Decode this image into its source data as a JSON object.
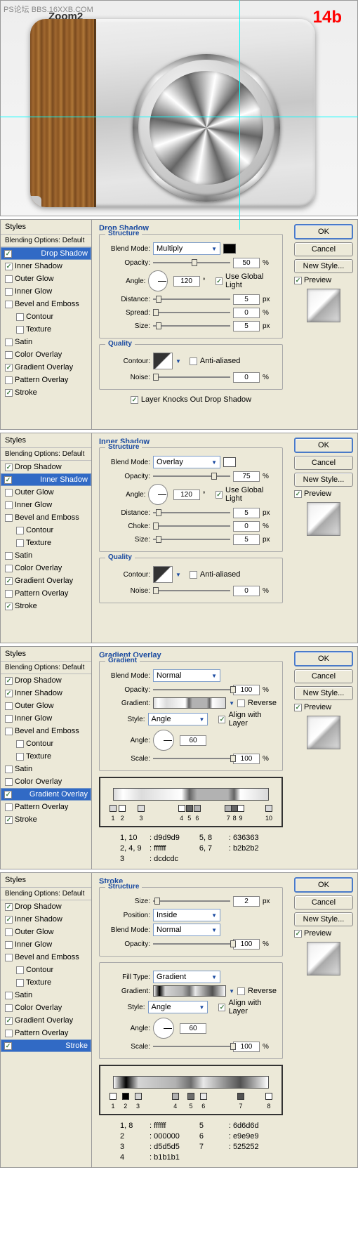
{
  "watermark": "PS论坛 BBS.16XXB.COM",
  "zoom_label": "Zoom2",
  "tag": "14b",
  "common": {
    "styles_header": "Styles",
    "blending_options": "Blending Options: Default",
    "items": [
      {
        "label": "Drop Shadow"
      },
      {
        "label": "Inner Shadow"
      },
      {
        "label": "Outer Glow"
      },
      {
        "label": "Inner Glow"
      },
      {
        "label": "Bevel and Emboss"
      },
      {
        "label": "Contour"
      },
      {
        "label": "Texture"
      },
      {
        "label": "Satin"
      },
      {
        "label": "Color Overlay"
      },
      {
        "label": "Gradient Overlay"
      },
      {
        "label": "Pattern Overlay"
      },
      {
        "label": "Stroke"
      }
    ],
    "ok": "OK",
    "cancel": "Cancel",
    "newstyle": "New Style...",
    "preview": "Preview"
  },
  "p1": {
    "title": "Drop Shadow",
    "structure": "Structure",
    "quality": "Quality",
    "blend_mode_label": "Blend Mode:",
    "blend_mode": "Multiply",
    "color": "#000000",
    "opacity_label": "Opacity:",
    "opacity": "50",
    "pct": "%",
    "angle_label": "Angle:",
    "angle": "120",
    "deg": "°",
    "globallight": "Use Global Light",
    "distance_label": "Distance:",
    "distance": "5",
    "px": "px",
    "spread_label": "Spread:",
    "spread": "0",
    "size_label": "Size:",
    "size": "5",
    "contour_label": "Contour:",
    "antialiased": "Anti-aliased",
    "noise_label": "Noise:",
    "noise": "0",
    "knockout": "Layer Knocks Out Drop Shadow"
  },
  "p2": {
    "title": "Inner Shadow",
    "structure": "Structure",
    "quality": "Quality",
    "blend_mode_label": "Blend Mode:",
    "blend_mode": "Overlay",
    "color": "#ffffff",
    "opacity_label": "Opacity:",
    "opacity": "75",
    "pct": "%",
    "angle_label": "Angle:",
    "angle": "120",
    "deg": "°",
    "globallight": "Use Global Light",
    "distance_label": "Distance:",
    "distance": "5",
    "px": "px",
    "choke_label": "Choke:",
    "choke": "0",
    "size_label": "Size:",
    "size": "5",
    "contour_label": "Contour:",
    "antialiased": "Anti-aliased",
    "noise_label": "Noise:",
    "noise": "0"
  },
  "p3": {
    "title": "Gradient Overlay",
    "gradient": "Gradient",
    "blend_mode_label": "Blend Mode:",
    "blend_mode": "Normal",
    "opacity_label": "Opacity:",
    "opacity": "100",
    "pct": "%",
    "gradient_label": "Gradient:",
    "reverse": "Reverse",
    "style_label": "Style:",
    "style": "Angle",
    "align": "Align with Layer",
    "angle_label": "Angle:",
    "angle": "60",
    "scale_label": "Scale:",
    "scale": "100",
    "stops": [
      {
        "n": "1",
        "pos": 0,
        "c": "#d9d9d9"
      },
      {
        "n": "2",
        "pos": 6,
        "c": "#ffffff"
      },
      {
        "n": "3",
        "pos": 18,
        "c": "#dcdcdc"
      },
      {
        "n": "4",
        "pos": 44,
        "c": "#ffffff"
      },
      {
        "n": "5",
        "pos": 49,
        "c": "#636363"
      },
      {
        "n": "6",
        "pos": 54,
        "c": "#b2b2b2"
      },
      {
        "n": "7",
        "pos": 74,
        "c": "#b2b2b2"
      },
      {
        "n": "8",
        "pos": 78,
        "c": "#636363"
      },
      {
        "n": "9",
        "pos": 82,
        "c": "#ffffff"
      },
      {
        "n": "10",
        "pos": 100,
        "c": "#d9d9d9"
      }
    ],
    "legend": [
      {
        "a": "1, 10",
        "b": ": d9d9d9"
      },
      {
        "a": "2, 4, 9",
        "b": ": ffffff"
      },
      {
        "a": "3",
        "b": ": dcdcdc"
      },
      {
        "a": "5, 8",
        "b": ": 636363"
      },
      {
        "a": "6, 7",
        "b": ": b2b2b2"
      }
    ]
  },
  "p4": {
    "title": "Stroke",
    "structure": "Structure",
    "size_label": "Size:",
    "size": "2",
    "px": "px",
    "position_label": "Position:",
    "position": "Inside",
    "blend_mode_label": "Blend Mode:",
    "blend_mode": "Normal",
    "opacity_label": "Opacity:",
    "opacity": "100",
    "pct": "%",
    "filltype_label": "Fill Type:",
    "filltype": "Gradient",
    "gradient_label": "Gradient:",
    "reverse": "Reverse",
    "style_label": "Style:",
    "style": "Angle",
    "align": "Align with Layer",
    "angle_label": "Angle:",
    "angle": "60",
    "scale_label": "Scale:",
    "scale": "100",
    "stops": [
      {
        "n": "1",
        "pos": 0,
        "c": "#ffffff"
      },
      {
        "n": "2",
        "pos": 8,
        "c": "#000000"
      },
      {
        "n": "3",
        "pos": 16,
        "c": "#d5d5d5"
      },
      {
        "n": "4",
        "pos": 40,
        "c": "#b1b1b1"
      },
      {
        "n": "5",
        "pos": 50,
        "c": "#6d6d6d"
      },
      {
        "n": "6",
        "pos": 58,
        "c": "#e9e9e9"
      },
      {
        "n": "7",
        "pos": 82,
        "c": "#525252"
      },
      {
        "n": "8",
        "pos": 100,
        "c": "#ffffff"
      }
    ],
    "legend": [
      {
        "a": "1, 8",
        "b": ": ffffff"
      },
      {
        "a": "2",
        "b": ": 000000"
      },
      {
        "a": "3",
        "b": ": d5d5d5"
      },
      {
        "a": "4",
        "b": ": b1b1b1"
      },
      {
        "a": "5",
        "b": ": 6d6d6d"
      },
      {
        "a": "6",
        "b": ": e9e9e9"
      },
      {
        "a": "7",
        "b": ": 525252"
      }
    ]
  }
}
